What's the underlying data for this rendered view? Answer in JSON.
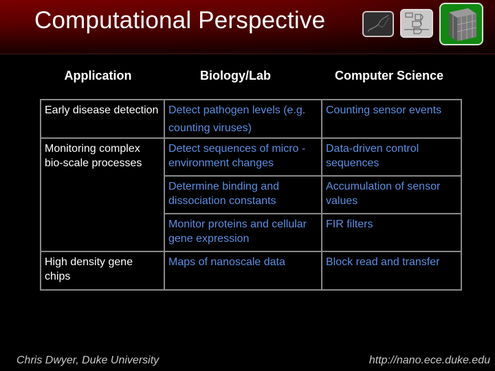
{
  "slide": {
    "title": "Computational Perspective",
    "thumbnails": [
      {
        "name": "dna-strand-image"
      },
      {
        "name": "logic-circuit-image"
      },
      {
        "name": "nanostructure-cube-image"
      }
    ]
  },
  "table": {
    "headers": [
      "Application",
      "Biology/Lab",
      "Computer Science"
    ],
    "rows": [
      {
        "application": "Early disease detection",
        "biology": "Detect pathogen levels (e.g. counting viruses)",
        "cs": "Counting sensor events"
      },
      {
        "application": "Monitoring complex bio-scale processes",
        "biology": "Detect sequences of micro -environment changes",
        "cs": "Data-driven control sequences"
      },
      {
        "application": "",
        "biology": "Determine binding and dissociation constants",
        "cs": "Accumulation of sensor values"
      },
      {
        "application": "",
        "biology": "Monitor proteins and cellular gene expression",
        "cs": "FIR filters"
      },
      {
        "application": "High density gene chips",
        "biology": "Maps of nanoscale data",
        "cs": "Block read and transfer"
      }
    ]
  },
  "footer": {
    "author": "Chris Dwyer, Duke University",
    "url": "http://nano.ece.duke.edu"
  },
  "colors": {
    "header_red": "#7a0000",
    "link_blue": "#5b8fe0",
    "grid_gray": "#8a8a8a"
  }
}
